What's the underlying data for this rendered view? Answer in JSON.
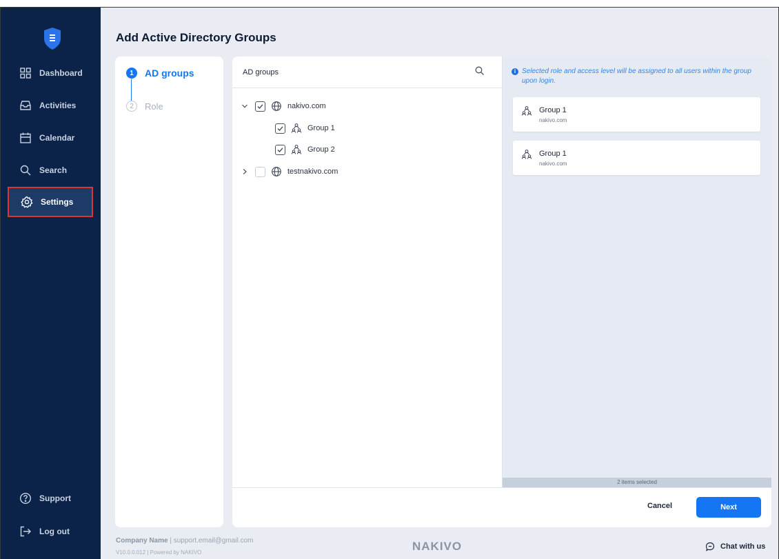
{
  "sidebar": {
    "items": [
      {
        "label": "Dashboard",
        "icon": "dashboard-icon"
      },
      {
        "label": "Activities",
        "icon": "inbox-icon"
      },
      {
        "label": "Calendar",
        "icon": "calendar-icon"
      },
      {
        "label": "Search",
        "icon": "search-icon"
      },
      {
        "label": "Settings",
        "icon": "gear-icon"
      }
    ],
    "bottom": [
      {
        "label": "Support",
        "icon": "question-icon"
      },
      {
        "label": "Log out",
        "icon": "logout-icon"
      }
    ],
    "active_item": "Settings",
    "active_outline_color": "#e0352f"
  },
  "page": {
    "title": "Add Active Directory Groups"
  },
  "steps": [
    {
      "number": "1",
      "label": "AD groups"
    },
    {
      "number": "2",
      "label": "Role"
    }
  ],
  "tree": {
    "title": "AD groups",
    "nodes": [
      {
        "label": "nakivo.com"
      },
      {
        "label": "Group 1"
      },
      {
        "label": "Group 2"
      },
      {
        "label": "testnakivo.com"
      }
    ]
  },
  "selection": {
    "info": "Selected role and access level will be assigned to all users within the group upon login.",
    "items": [
      {
        "name": "Group 1",
        "domain": "nakivo.com"
      },
      {
        "name": "Group 1",
        "domain": "nakivo.com"
      }
    ],
    "footer": "2 items selected"
  },
  "actions": {
    "cancel": "Cancel",
    "next": "Next"
  },
  "footer": {
    "company": "Company Name",
    "email": "| support.email@gmail.com",
    "version": "V10.0.0.012 | Powered by NAKIVO",
    "brand": "NAKIVO",
    "chat": "Chat with us"
  },
  "colors": {
    "accent": "#1476f2",
    "sidebar_bg": "#0b2349",
    "info_text": "#2a86f0"
  }
}
